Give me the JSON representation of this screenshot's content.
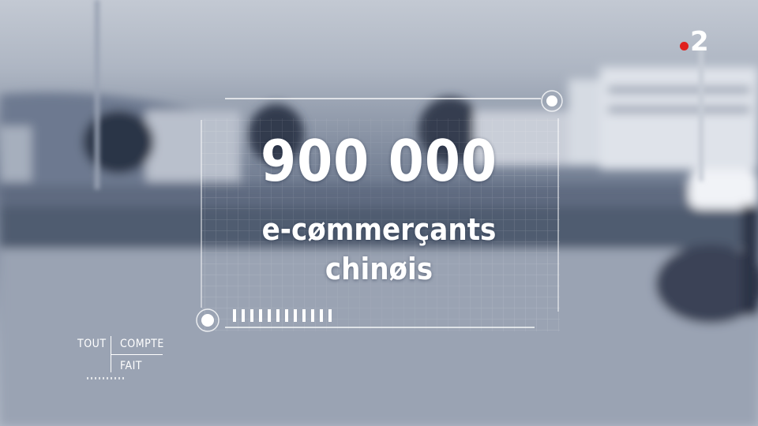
{
  "overlay": {
    "value": "900 000",
    "line1": "e-cømmerçants",
    "line2": "chinøis"
  },
  "channel_logo": {
    "number": "2",
    "dot_color": "#e0201e"
  },
  "show_logo": {
    "word1": "TOUT",
    "word2": "COMPTE",
    "word3": "FAIT"
  },
  "progress_ticks": 12
}
